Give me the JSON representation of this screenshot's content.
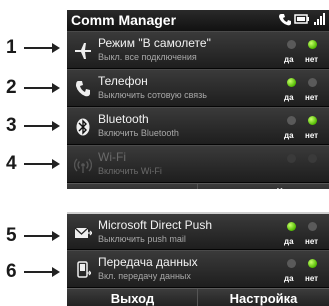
{
  "title": "Comm Manager",
  "callouts": [
    "1",
    "2",
    "3",
    "4",
    "5",
    "6"
  ],
  "rows_top": [
    {
      "label": "Режим \"В самолете\"",
      "sub": "Выкл. все подключения",
      "icon": "airplane-icon",
      "state": "no",
      "disabled": false
    },
    {
      "label": "Телефон",
      "sub": "Выключить сотовую связь",
      "icon": "phone-icon",
      "state": "yes",
      "disabled": false
    },
    {
      "label": "Bluetooth",
      "sub": "Включить Bluetooth",
      "icon": "bluetooth-icon",
      "state": "no",
      "disabled": false
    },
    {
      "label": "Wi-Fi",
      "sub": "Включить Wi-Fi",
      "icon": "wifi-icon",
      "state": "none",
      "disabled": true
    }
  ],
  "rows_bottom": [
    {
      "label": "Microsoft Direct Push",
      "sub": "Выключить push mail",
      "icon": "mail-icon",
      "state": "yes",
      "disabled": false
    },
    {
      "label": "Передача данных",
      "sub": "Вкл. передачу данных",
      "icon": "data-connection-icon",
      "state": "no",
      "disabled": false
    }
  ],
  "toggle_labels": {
    "yes": "да",
    "no": "нет"
  },
  "softkeys": {
    "left": "Выход",
    "right": "Настройка"
  },
  "colors": {
    "on": "#4fb800",
    "off": "#5a5a5a"
  }
}
